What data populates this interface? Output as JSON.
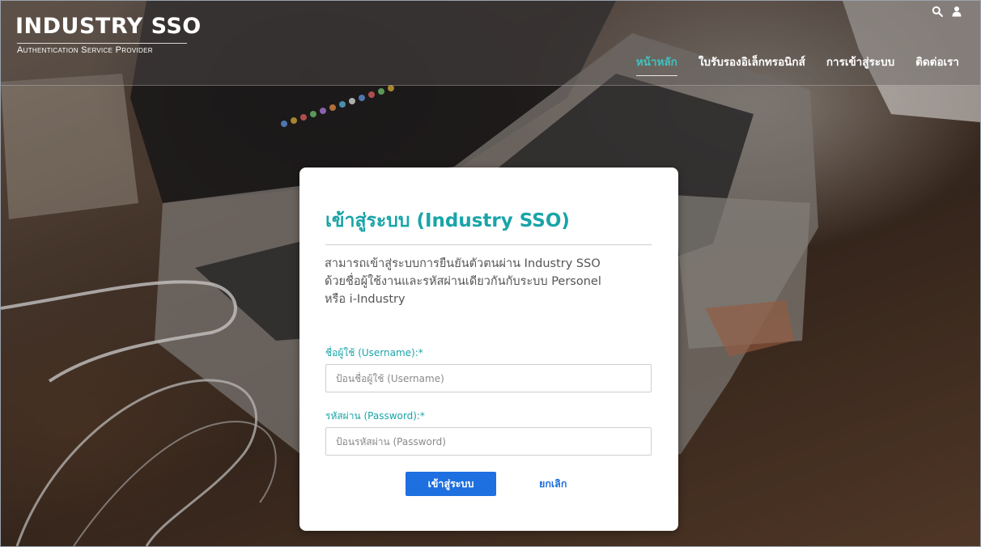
{
  "brand": {
    "title": "INDUSTRY SSO",
    "subtitle": "Authentication Service Provider"
  },
  "top_icons": [
    "search-icon",
    "user-icon"
  ],
  "nav": {
    "items": [
      {
        "label": "หน้าหลัก",
        "active": true
      },
      {
        "label": "ใบรับรองอิเล็กทรอนิกส์",
        "active": false
      },
      {
        "label": "การเข้าสู่ระบบ",
        "active": false
      },
      {
        "label": "ติดต่อเรา",
        "active": false
      }
    ]
  },
  "login": {
    "title": "เข้าสู่ระบบ (Industry SSO)",
    "description_lines": [
      "สามารถเข้าสู่ระบบการยืนยันตัวตนผ่าน Industry SSO",
      "ด้วยชื่อผู้ใช้งานและรหัสผ่านเดียวกันกับระบบ Personel",
      "หรือ i-Industry"
    ],
    "username_label": "ชื่อผู้ใช้ (Username):*",
    "username_placeholder": "ป้อนชื่อผู้ใช้ (Username)",
    "username_value": "",
    "password_label": "รหัสผ่าน (Password):*",
    "password_placeholder": "ป้อนรหัสผ่าน (Password)",
    "password_value": "",
    "submit_label": "เข้าสู่ระบบ",
    "cancel_label": "ยกเลิก"
  },
  "colors": {
    "accent_teal": "#1aa4a8",
    "nav_active": "#3fc3c0",
    "button_blue": "#1e6fe0",
    "header_overlay": "#5f5a56"
  }
}
